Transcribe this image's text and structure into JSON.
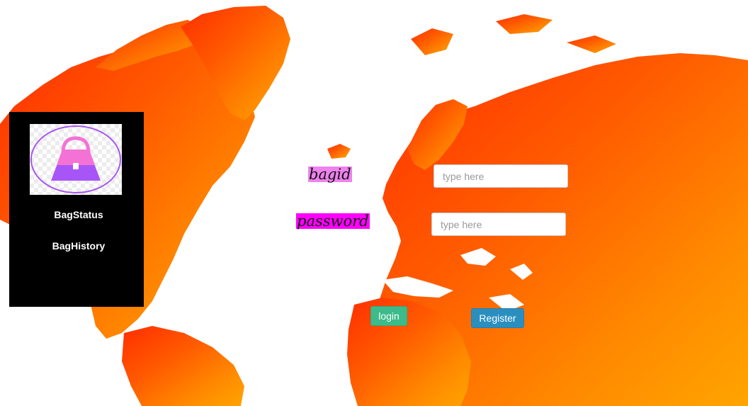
{
  "colors": {
    "map_gradient": [
      "#ff2d00",
      "#ff5a00",
      "#ff8a00",
      "#ffa500"
    ],
    "sidebar_bg": "#000000",
    "bagid_label_bg": "#ee82ee",
    "password_label_bg": "#ff00ff",
    "login_button": "#3dbb8a",
    "register_button": "#2a8fbf",
    "logo_bag": "#a855f7",
    "logo_handle": "#f472d6"
  },
  "background": {
    "icon": "world-map"
  },
  "sidebar": {
    "logo_icon": "handbag-icon",
    "items": [
      {
        "label": "BagStatus"
      },
      {
        "label": "BagHistory"
      }
    ]
  },
  "form": {
    "bagid": {
      "label": "bagid",
      "placeholder": "type here",
      "value": ""
    },
    "password": {
      "label": "password",
      "placeholder": "type here",
      "value": ""
    },
    "login_label": "login",
    "register_label": "Register"
  }
}
